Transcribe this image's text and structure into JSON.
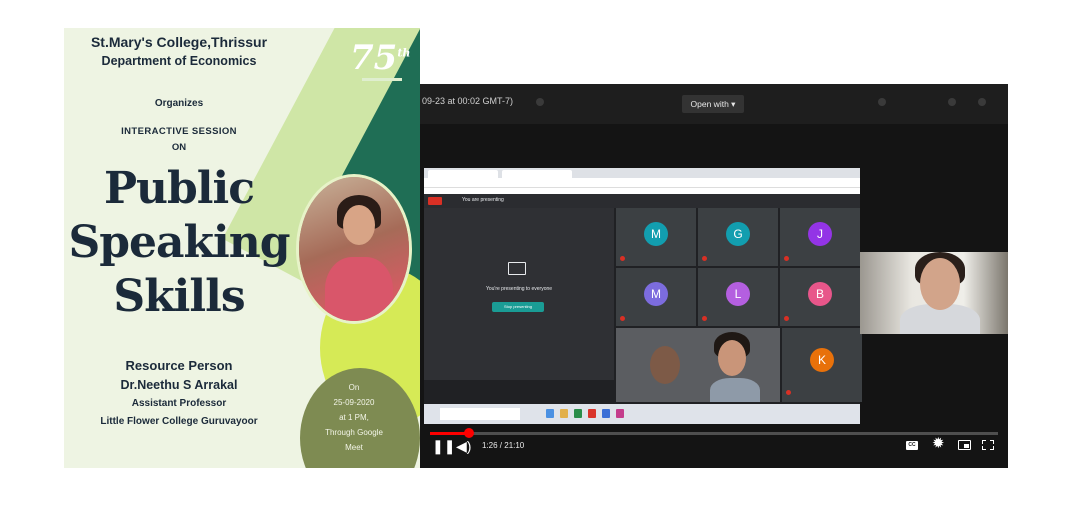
{
  "poster": {
    "college": "St.Mary's College,Thrissur",
    "department": "Department of Economics",
    "organizes": "Organizes",
    "session_line1": "INTERACTIVE SESSION",
    "session_line2": "ON",
    "title_line1": "Public",
    "title_line2": "Speaking",
    "title_line3": "Skills",
    "resource_heading": "Resource Person",
    "person_name": "Dr.Neethu S Arrakal",
    "person_role": "Assistant Professor",
    "person_affiliation": "Little Flower College Guruvayoor",
    "anniversary": "75",
    "anniversary_suffix": "th",
    "event_on": "On",
    "event_date": "25-09-2020",
    "event_time": "at 1 PM,",
    "event_via": "Through Google",
    "event_platform": "Meet",
    "colors": {
      "accent_green": "#4a8a2c",
      "dark_teal": "#1f6e55",
      "lime": "#d6ea56",
      "olive": "#7e8b52"
    }
  },
  "video": {
    "top_timestamp": "09-23 at 00:02 GMT-7)",
    "open_with_label": "Open with",
    "meet": {
      "presenting_status": "You are presenting",
      "presenting_message": "You're presenting to everyone",
      "stop_button": "Stop presenting",
      "participants": [
        {
          "initial": "M",
          "color": "#129eaf"
        },
        {
          "initial": "G",
          "color": "#129eaf"
        },
        {
          "initial": "J",
          "color": "#9334e6"
        },
        {
          "initial": "M",
          "color": "#7c6cde"
        },
        {
          "initial": "L",
          "color": "#b45fe0"
        },
        {
          "initial": "B",
          "color": "#e8568a"
        },
        {
          "initial": "K",
          "color": "#e8710a"
        }
      ]
    },
    "player": {
      "time": "1:26 / 21:10",
      "progress_fraction": 0.068,
      "cc_label": "CC",
      "icons": [
        "pause-icon",
        "volume-icon",
        "captions-icon",
        "settings-icon",
        "miniplayer-icon",
        "fullscreen-icon"
      ]
    }
  }
}
